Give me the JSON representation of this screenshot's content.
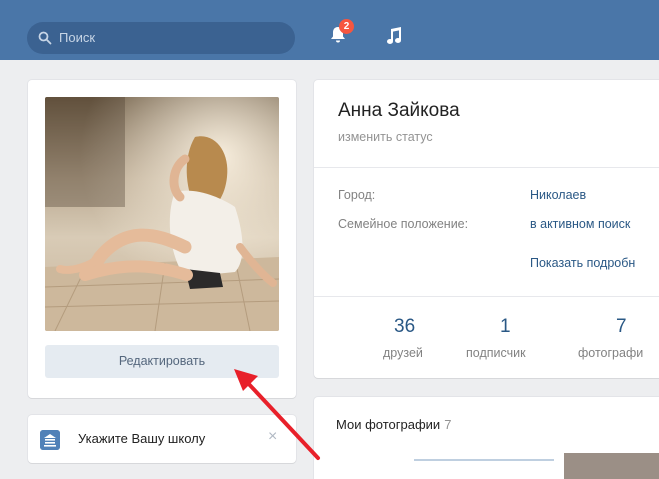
{
  "header": {
    "search_placeholder": "Поиск",
    "notifications_count": "2"
  },
  "profile": {
    "edit_label": "Редактировать",
    "name": "Анна Зайкова",
    "status_link": "изменить статус",
    "info": [
      {
        "label": "Город:",
        "value": "Николаев"
      },
      {
        "label": "Семейное положение:",
        "value": "в активном поиск"
      }
    ],
    "show_details": "Показать подробн",
    "counters": [
      {
        "value": "36",
        "label": "друзей"
      },
      {
        "value": "1",
        "label": "подписчик"
      },
      {
        "value": "7",
        "label": "фотографи"
      }
    ]
  },
  "school_prompt": {
    "label": "Укажите Вашу школу",
    "close": "×"
  },
  "photos": {
    "title": "Мои фотографии",
    "count": "7"
  },
  "colors": {
    "header_bg": "#4a76a8",
    "link": "#2a5885",
    "annotation_arrow": "#e8202a"
  },
  "icons": [
    "search-icon",
    "bell-icon",
    "music-icon",
    "school-icon",
    "close-icon"
  ]
}
